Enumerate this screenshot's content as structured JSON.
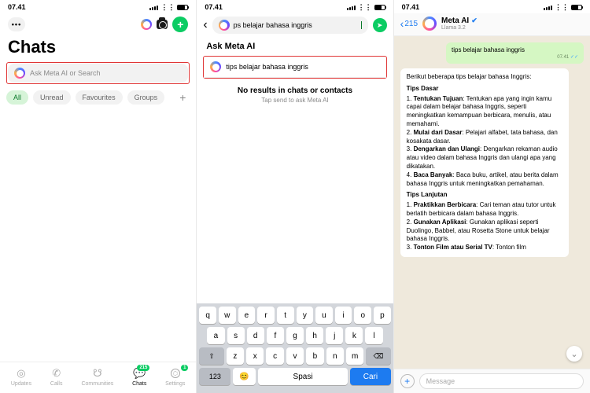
{
  "status": {
    "time": "07.41",
    "wifi": "wifi",
    "battery": 70
  },
  "pane1": {
    "title": "Chats",
    "search_placeholder": "Ask Meta AI or Search",
    "filters": [
      "All",
      "Unread",
      "Favourites",
      "Groups"
    ],
    "tabs": [
      {
        "label": "Updates",
        "badge": ""
      },
      {
        "label": "Calls",
        "badge": ""
      },
      {
        "label": "Communities",
        "badge": ""
      },
      {
        "label": "Chats",
        "badge": "215"
      },
      {
        "label": "Settings",
        "badge": "1"
      }
    ]
  },
  "pane2": {
    "search_value": "ps belajar bahasa inggris",
    "ask_heading": "Ask Meta AI",
    "suggestion": "tips belajar bahasa inggris",
    "no_results": "No results in chats or contacts",
    "no_results_sub": "Tap send to ask Meta AI",
    "keys_r1": [
      "q",
      "w",
      "e",
      "r",
      "t",
      "y",
      "u",
      "i",
      "o",
      "p"
    ],
    "keys_r2": [
      "a",
      "s",
      "d",
      "f",
      "g",
      "h",
      "j",
      "k",
      "l"
    ],
    "keys_r3": [
      "z",
      "x",
      "c",
      "v",
      "b",
      "n",
      "m"
    ],
    "shift": "⇧",
    "bksp": "⌫",
    "numkey": "123",
    "emoji": "😊",
    "space": "Spasi",
    "enter": "Cari"
  },
  "pane3": {
    "back_count": "215",
    "name": "Meta AI",
    "model": "Llama 3.2",
    "user_msg": "tips belajar bahasa inggris",
    "ts": "07.41",
    "ai": {
      "intro": "Berikut beberapa tips belajar bahasa Inggris:",
      "h1": "Tips Dasar",
      "p1n": "1.  ",
      "p1b": "Tentukan Tujuan",
      "p1": ": Tentukan apa yang ingin kamu capai dalam belajar bahasa Inggris, seperti meningkatkan kemampuan berbicara, menulis, atau memahami.",
      "p2n": "2.  ",
      "p2b": "Mulai dari Dasar",
      "p2": ": Pelajari alfabet, tata bahasa, dan kosakata dasar.",
      "p3n": "3.  ",
      "p3b": "Dengarkan dan Ulangi",
      "p3": ": Dengarkan rekaman audio atau video dalam bahasa Inggris dan ulangi apa yang dikatakan.",
      "p4n": "4.  ",
      "p4b": "Baca Banyak",
      "p4": ": Baca buku, artikel, atau berita dalam bahasa Inggris untuk meningkatkan pemahaman.",
      "h2": "Tips Lanjutan",
      "q1n": "1.  ",
      "q1b": "Praktikkan Berbicara",
      "q1": ": Cari teman atau tutor untuk berlatih berbicara dalam bahasa Inggris.",
      "q2n": "2.  ",
      "q2b": "Gunakan Aplikasi",
      "q2": ": Gunakan aplikasi seperti Duolingo, Babbel, atau Rosetta Stone untuk belajar bahasa Inggris.",
      "q3n": "3.  ",
      "q3b": "Tonton Film atau Serial TV",
      "q3": ": Tonton film"
    },
    "compose_placeholder": "Message"
  }
}
